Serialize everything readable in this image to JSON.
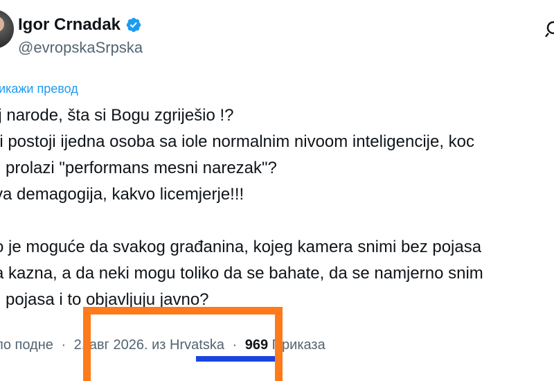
{
  "author": {
    "name": "Igor Crnadak",
    "handle": "@evropskaSrpska"
  },
  "icons": {
    "verified": "verified-badge-icon",
    "more": "grok-icon",
    "accent": "#1d9bf0"
  },
  "translate_label": "рикажи превод",
  "tweet_lines": [
    "ој narode, šta si Bogu zgriješio !?",
    "li postoji ijedna osoba sa iole normalnim nivoom inteligencije, koc",
    "prolazi \"performans mesni narezak\"?",
    "va demagogija, kakvo licemjerje!!!",
    "",
    "o je moguće da svakog građanina, kojeg kamera snimi bez pojasa",
    "a kazna, a da neki mogu toliko da se bahate, da se namjerno snim",
    "pojasa i to objavljuju javno?"
  ],
  "meta": {
    "time": "по подне",
    "date": "2. авг 2026.",
    "from_label": "из",
    "country": "Hrvatska",
    "views_count": "969",
    "views_label": "Приказа"
  },
  "annotation_colors": {
    "box": "#ff7a1a",
    "underline": "#1a44e0"
  }
}
